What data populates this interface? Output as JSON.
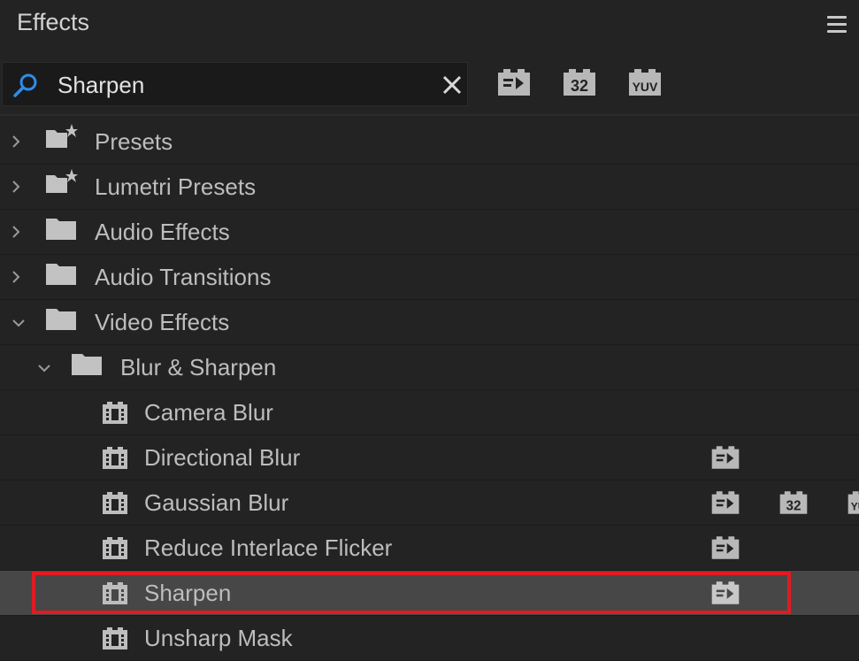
{
  "panel": {
    "title": "Effects"
  },
  "search": {
    "value": "Sharpen",
    "placeholder": ""
  },
  "toolbar": {
    "badges": [
      {
        "name": "accelerated-effects-filter",
        "icon": "accelerated-effect-icon"
      },
      {
        "name": "32-bit-filter",
        "text": "32"
      },
      {
        "name": "yuv-filter",
        "text": "YUV"
      }
    ]
  },
  "tree": [
    {
      "label": "Presets",
      "expanded": false,
      "icon": "preset-folder-icon"
    },
    {
      "label": "Lumetri Presets",
      "expanded": false,
      "icon": "preset-folder-icon"
    },
    {
      "label": "Audio Effects",
      "expanded": false,
      "icon": "folder-icon"
    },
    {
      "label": "Audio Transitions",
      "expanded": false,
      "icon": "folder-icon"
    },
    {
      "label": "Video Effects",
      "expanded": true,
      "icon": "folder-icon"
    },
    {
      "label": "Blur & Sharpen",
      "expanded": true,
      "icon": "folder-icon"
    },
    {
      "label": "Camera Blur",
      "icon": "effect-icon",
      "badges": []
    },
    {
      "label": "Directional Blur",
      "icon": "effect-icon",
      "badges": [
        "accelerated"
      ]
    },
    {
      "label": "Gaussian Blur",
      "icon": "effect-icon",
      "badges": [
        "accelerated",
        "32",
        "YUV"
      ]
    },
    {
      "label": "Reduce Interlace Flicker",
      "icon": "effect-icon",
      "badges": [
        "accelerated"
      ]
    },
    {
      "label": "Sharpen",
      "icon": "effect-icon",
      "badges": [
        "accelerated"
      ],
      "selected": true
    },
    {
      "label": "Unsharp Mask",
      "icon": "effect-icon",
      "badges": []
    }
  ],
  "colors": {
    "background": "#232323",
    "selection": "#474747",
    "highlight": "#e01b22",
    "search_icon": "#2d8ceb"
  }
}
